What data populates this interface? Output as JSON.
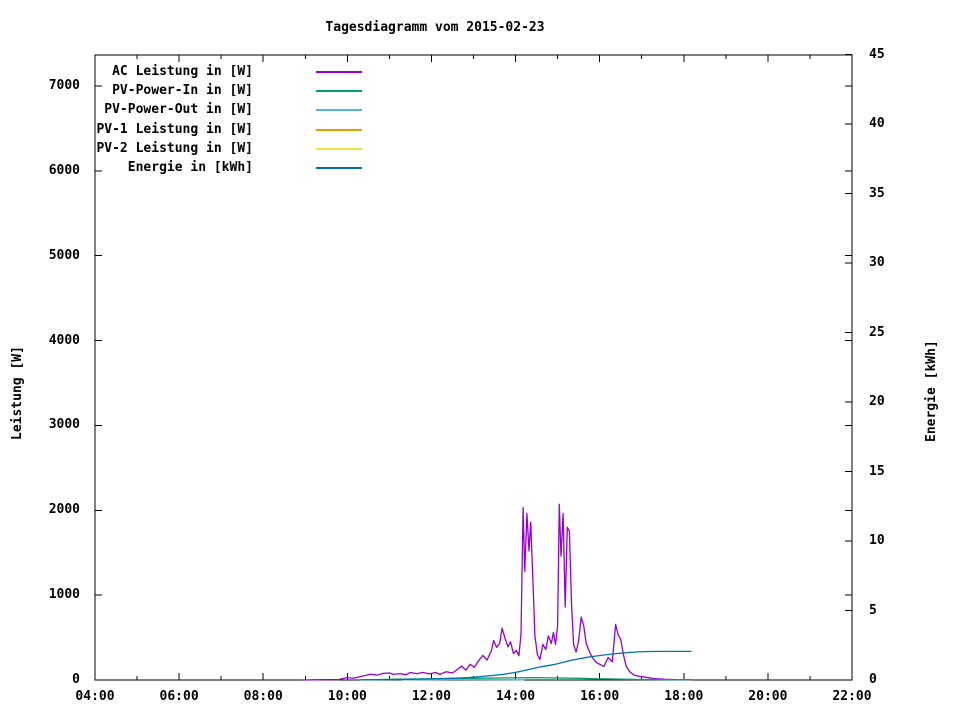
{
  "chart_data": {
    "type": "line",
    "title": "Tagesdiagramm vom 2015-02-23",
    "grid": false,
    "legend_position": "top-left-inside",
    "x_axis": {
      "unit": "time HH:MM",
      "start_hour": 4,
      "end_hour": 22,
      "major_ticks": [
        {
          "hour": 4,
          "label": "04:00"
        },
        {
          "hour": 6,
          "label": "06:00"
        },
        {
          "hour": 8,
          "label": "08:00"
        },
        {
          "hour": 10,
          "label": "10:00"
        },
        {
          "hour": 12,
          "label": "12:00"
        },
        {
          "hour": 14,
          "label": "14:00"
        },
        {
          "hour": 16,
          "label": "16:00"
        },
        {
          "hour": 18,
          "label": "18:00"
        },
        {
          "hour": 20,
          "label": "20:00"
        },
        {
          "hour": 22,
          "label": "22:00"
        }
      ],
      "minor_tick_hours": [
        5,
        7,
        9,
        11,
        13,
        15,
        17,
        19,
        21
      ]
    },
    "y1_axis": {
      "label": "Leistung [W]",
      "tick_values": [
        0,
        1000,
        2000,
        3000,
        4000,
        5000,
        6000,
        7000
      ],
      "range": [
        0,
        7370
      ]
    },
    "y2_axis": {
      "label": "Energie [kWh]",
      "tick_values": [
        0,
        5,
        10,
        15,
        20,
        25,
        30,
        35,
        40,
        45
      ],
      "range": [
        0,
        45
      ]
    },
    "series": [
      {
        "name": "AC Leistung in [W]",
        "color": "#9400d3",
        "axis": "y1",
        "points": [
          [
            9.0,
            0
          ],
          [
            9.2,
            2
          ],
          [
            9.5,
            3
          ],
          [
            9.8,
            5
          ],
          [
            9.9,
            18
          ],
          [
            10.0,
            28
          ],
          [
            10.15,
            22
          ],
          [
            10.3,
            38
          ],
          [
            10.45,
            55
          ],
          [
            10.55,
            68
          ],
          [
            10.7,
            58
          ],
          [
            10.85,
            78
          ],
          [
            11.0,
            82
          ],
          [
            11.1,
            66
          ],
          [
            11.25,
            76
          ],
          [
            11.4,
            62
          ],
          [
            11.5,
            88
          ],
          [
            11.65,
            76
          ],
          [
            11.8,
            88
          ],
          [
            11.95,
            72
          ],
          [
            12.1,
            88
          ],
          [
            12.2,
            66
          ],
          [
            12.35,
            98
          ],
          [
            12.5,
            82
          ],
          [
            12.62,
            125
          ],
          [
            12.72,
            165
          ],
          [
            12.82,
            115
          ],
          [
            12.92,
            185
          ],
          [
            13.02,
            150
          ],
          [
            13.12,
            225
          ],
          [
            13.22,
            290
          ],
          [
            13.32,
            235
          ],
          [
            13.42,
            340
          ],
          [
            13.48,
            465
          ],
          [
            13.55,
            385
          ],
          [
            13.62,
            430
          ],
          [
            13.68,
            610
          ],
          [
            13.75,
            490
          ],
          [
            13.82,
            390
          ],
          [
            13.88,
            450
          ],
          [
            13.95,
            310
          ],
          [
            14.02,
            350
          ],
          [
            14.08,
            285
          ],
          [
            14.13,
            540
          ],
          [
            14.18,
            2030
          ],
          [
            14.22,
            1280
          ],
          [
            14.27,
            1960
          ],
          [
            14.32,
            1520
          ],
          [
            14.36,
            1860
          ],
          [
            14.42,
            1080
          ],
          [
            14.46,
            520
          ],
          [
            14.52,
            300
          ],
          [
            14.58,
            240
          ],
          [
            14.65,
            420
          ],
          [
            14.72,
            360
          ],
          [
            14.78,
            520
          ],
          [
            14.85,
            430
          ],
          [
            14.9,
            560
          ],
          [
            14.95,
            420
          ],
          [
            15.0,
            640
          ],
          [
            15.04,
            2070
          ],
          [
            15.08,
            1460
          ],
          [
            15.13,
            1960
          ],
          [
            15.18,
            860
          ],
          [
            15.23,
            1800
          ],
          [
            15.28,
            1750
          ],
          [
            15.33,
            900
          ],
          [
            15.38,
            420
          ],
          [
            15.44,
            330
          ],
          [
            15.5,
            460
          ],
          [
            15.56,
            740
          ],
          [
            15.62,
            640
          ],
          [
            15.68,
            430
          ],
          [
            15.75,
            340
          ],
          [
            15.82,
            270
          ],
          [
            15.9,
            215
          ],
          [
            16.0,
            185
          ],
          [
            16.1,
            160
          ],
          [
            16.2,
            265
          ],
          [
            16.3,
            215
          ],
          [
            16.38,
            655
          ],
          [
            16.44,
            530
          ],
          [
            16.5,
            480
          ],
          [
            16.56,
            310
          ],
          [
            16.63,
            160
          ],
          [
            16.72,
            95
          ],
          [
            16.82,
            55
          ],
          [
            16.95,
            42
          ],
          [
            17.1,
            32
          ],
          [
            17.3,
            16
          ],
          [
            17.55,
            8
          ],
          [
            17.8,
            5
          ],
          [
            18.05,
            4
          ],
          [
            18.15,
            0
          ]
        ]
      },
      {
        "name": "PV-Power-In in [W]",
        "color": "#009e73",
        "axis": "y1",
        "points": [
          [
            10.3,
            3
          ],
          [
            10.8,
            6
          ],
          [
            11.2,
            9
          ],
          [
            12.0,
            14
          ],
          [
            13.0,
            20
          ],
          [
            14.0,
            26
          ],
          [
            14.5,
            28
          ],
          [
            15.0,
            24
          ],
          [
            15.5,
            20
          ],
          [
            16.0,
            14
          ],
          [
            16.5,
            10
          ],
          [
            17.0,
            6
          ],
          [
            17.5,
            4
          ],
          [
            18.2,
            3
          ]
        ]
      },
      {
        "name": "PV-Power-Out in [W]",
        "color": "#56b4e9",
        "axis": "y1",
        "points": [
          [
            11.3,
            2
          ],
          [
            12.0,
            4
          ],
          [
            12.6,
            6
          ],
          [
            13.2,
            5
          ],
          [
            13.8,
            3
          ],
          [
            14.2,
            2
          ]
        ]
      },
      {
        "name": "PV-1 Leistung in [W]",
        "color": "#e69f00",
        "axis": "y1",
        "points": []
      },
      {
        "name": "PV-2 Leistung in [W]",
        "color": "#f0e442",
        "axis": "y1",
        "points": []
      },
      {
        "name": "Energie in [kWh]",
        "color": "#0072b2",
        "axis": "y2",
        "points": [
          [
            10.4,
            0.01
          ],
          [
            11.0,
            0.03
          ],
          [
            11.5,
            0.05
          ],
          [
            12.0,
            0.08
          ],
          [
            12.5,
            0.12
          ],
          [
            12.9,
            0.18
          ],
          [
            13.3,
            0.28
          ],
          [
            13.7,
            0.4
          ],
          [
            14.0,
            0.55
          ],
          [
            14.3,
            0.75
          ],
          [
            14.6,
            0.95
          ],
          [
            14.9,
            1.1
          ],
          [
            15.1,
            1.25
          ],
          [
            15.3,
            1.4
          ],
          [
            15.5,
            1.52
          ],
          [
            15.7,
            1.63
          ],
          [
            15.9,
            1.72
          ],
          [
            16.1,
            1.8
          ],
          [
            16.3,
            1.87
          ],
          [
            16.5,
            1.93
          ],
          [
            16.7,
            1.98
          ],
          [
            16.9,
            2.02
          ],
          [
            17.2,
            2.05
          ],
          [
            17.6,
            2.06
          ],
          [
            18.17,
            2.06
          ]
        ]
      }
    ]
  },
  "colors": {
    "background": "#ffffff",
    "foreground": "#000000"
  }
}
